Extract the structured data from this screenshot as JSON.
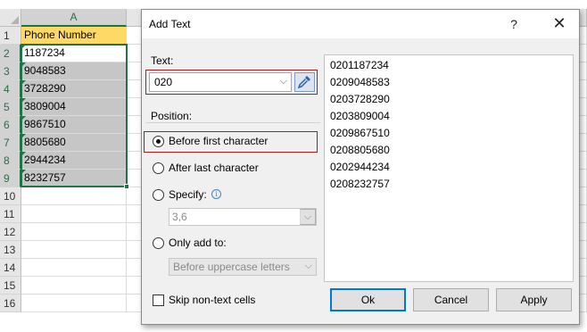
{
  "sheet": {
    "column_header": "A",
    "row_numbers": [
      "1",
      "2",
      "3",
      "4",
      "5",
      "6",
      "7",
      "8",
      "9",
      "10",
      "11",
      "12",
      "13",
      "14",
      "15",
      "16"
    ],
    "header_cell": "Phone Number",
    "values": [
      "1187234",
      "9048583",
      "3728290",
      "3809004",
      "9867510",
      "8805680",
      "2944234",
      "8232757"
    ]
  },
  "dialog": {
    "title": "Add Text",
    "help_label": "?",
    "close_label": "✕",
    "text_label": "Text:",
    "text_value": "020",
    "dropdown_arrow": "⌵",
    "position_label": "Position:",
    "options": {
      "before_first": "Before first character",
      "after_last": "After last character",
      "specify": "Specify:",
      "only_add_to": "Only add to:"
    },
    "specify_value": "3,6",
    "only_add_value": "Before uppercase letters",
    "skip_label": "Skip non-text cells",
    "preview": [
      "0201187234",
      "0209048583",
      "0203728290",
      "0203809004",
      "0209867510",
      "0208805680",
      "0202944234",
      "0208232757"
    ],
    "buttons": {
      "ok": "Ok",
      "cancel": "Cancel",
      "apply": "Apply"
    },
    "info_glyph": "i"
  },
  "colors": {
    "excel_green": "#217346",
    "header_fill": "#ffd966",
    "highlight_red": "#b01818",
    "default_button_blue": "#0078d7"
  }
}
